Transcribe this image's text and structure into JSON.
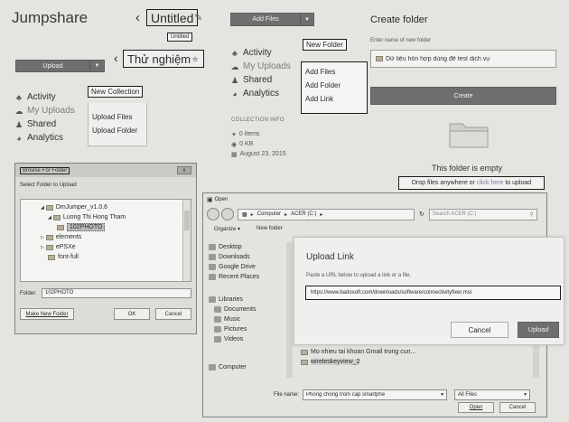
{
  "left_panel": {
    "app_title": "Jumpshare",
    "untitled_label": "Untitled",
    "untitled_tooltip": "Untitled",
    "rename_value": "Thử nghiệm",
    "upload_button": "Upload",
    "new_collection": "New Collection",
    "upload_menu": [
      "Upload Files",
      "Upload Folder"
    ],
    "nav": [
      "Activity",
      "My Uploads",
      "Shared",
      "Analytics"
    ]
  },
  "middle_panel": {
    "add_files_button": "Add Files",
    "new_folder": "New Folder",
    "nav": [
      "Activity",
      "My Uploads",
      "Shared",
      "Analytics"
    ],
    "add_menu": [
      "Add Files",
      "Add Folder",
      "Add Link"
    ],
    "collection_info_heading": "COLLECTION INFO",
    "collection_info": [
      "0 items",
      "0 KB",
      "August 23, 2015"
    ]
  },
  "right_panel": {
    "title": "Create folder",
    "name_label": "Enter name of new folder",
    "name_value": "Dữ liệu hỗn hợp dùng để test dịch vụ",
    "create_button": "Create",
    "empty_title": "This folder is empty",
    "drop_hint_prefix": "Drop files anywhere or ",
    "drop_hint_link": "click here",
    "drop_hint_suffix": " to upload"
  },
  "browse_dialog": {
    "title": "Browse For Folder",
    "instruction": "Select Folder to Upload",
    "tree": [
      "DmJumper_v1.0.6",
      "Luong Thi Hong Tham",
      "102PHOTO",
      "elements",
      "ePSXe",
      "font-full"
    ],
    "folder_label": "Folder:",
    "folder_value": "102PHOTO",
    "make_new_folder": "Make New Folder",
    "ok": "OK",
    "cancel": "Cancel"
  },
  "open_dialog": {
    "title": "Open",
    "path": [
      "Computer",
      "ACER (C:)"
    ],
    "search_placeholder": "Search ACER (C:)",
    "organize": "Organize ▾",
    "new_folder": "New folder",
    "sidebar": [
      "Desktop",
      "Downloads",
      "Google Drive",
      "Recent Places",
      "Libraries",
      "Documents",
      "Music",
      "Pictures",
      "Videos",
      "Computer"
    ],
    "files": [
      "Mo nhieu tai khoan Gmail trong cun...",
      "wireleskeyview_2"
    ],
    "filename_label": "File name:",
    "filename_value": "Phong chong trom cap smartphe",
    "filter_value": "All Files",
    "open_button": "Open",
    "cancel_button": "Cancel"
  },
  "upload_link_dialog": {
    "title": "Upload Link",
    "instruction": "Paste a URL below to upload a link or a file.",
    "url_value": "https://www.badosoft.com/downloads/software/connectivityfixer.msi",
    "cancel": "Cancel",
    "upload": "Upload"
  }
}
